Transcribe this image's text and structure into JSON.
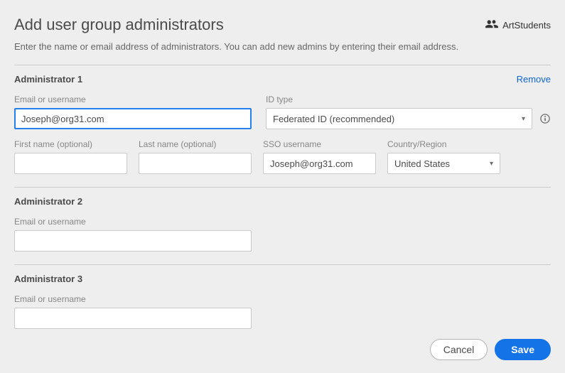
{
  "header": {
    "title": "Add user group administrators",
    "group_name": "ArtStudents",
    "subtext": "Enter the name or email address of administrators. You can add new admins by entering their email address."
  },
  "labels": {
    "email": "Email or username",
    "id_type": "ID type",
    "first_name": "First name (optional)",
    "last_name": "Last name (optional)",
    "sso_username": "SSO username",
    "country": "Country/Region"
  },
  "admins": [
    {
      "title": "Administrator 1",
      "remove_label": "Remove",
      "email_value": "Joseph@org31.com",
      "id_type_value": "Federated ID (recommended)",
      "first_name_value": "",
      "last_name_value": "",
      "sso_username_value": "Joseph@org31.com",
      "country_value": "United States",
      "expanded": true
    },
    {
      "title": "Administrator 2",
      "email_value": "",
      "expanded": false
    },
    {
      "title": "Administrator 3",
      "email_value": "",
      "expanded": false
    }
  ],
  "footer": {
    "cancel": "Cancel",
    "save": "Save"
  }
}
